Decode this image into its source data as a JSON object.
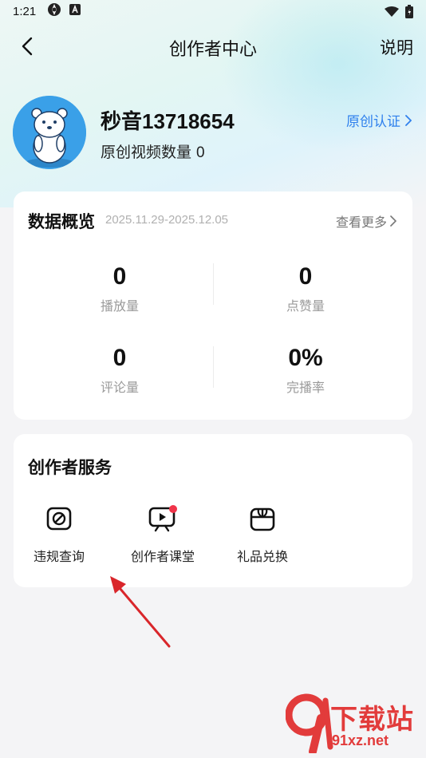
{
  "status_bar": {
    "time": "1:21"
  },
  "nav": {
    "title": "创作者中心",
    "help": "说明"
  },
  "profile": {
    "username": "秒音13718654",
    "video_count_label": "原创视频数量",
    "video_count": "0",
    "certify_label": "原创认证"
  },
  "overview": {
    "title": "数据概览",
    "date_range": "2025.11.29-2025.12.05",
    "see_more": "查看更多",
    "stats": [
      {
        "value": "0",
        "label": "播放量"
      },
      {
        "value": "0",
        "label": "点赞量"
      },
      {
        "value": "0",
        "label": "评论量"
      },
      {
        "value": "0%",
        "label": "完播率"
      }
    ]
  },
  "services": {
    "title": "创作者服务",
    "items": [
      {
        "label": "违规查询",
        "icon": "violation-check-icon"
      },
      {
        "label": "创作者课堂",
        "icon": "tv-class-icon"
      },
      {
        "label": "礼品兑换",
        "icon": "gift-box-icon"
      }
    ]
  },
  "watermark": {
    "top": "下载站",
    "bottom": "91xz.net"
  },
  "colors": {
    "accent_blue": "#2f80ed",
    "annotation_red": "#d9262b",
    "badge_red": "#f0344a"
  }
}
